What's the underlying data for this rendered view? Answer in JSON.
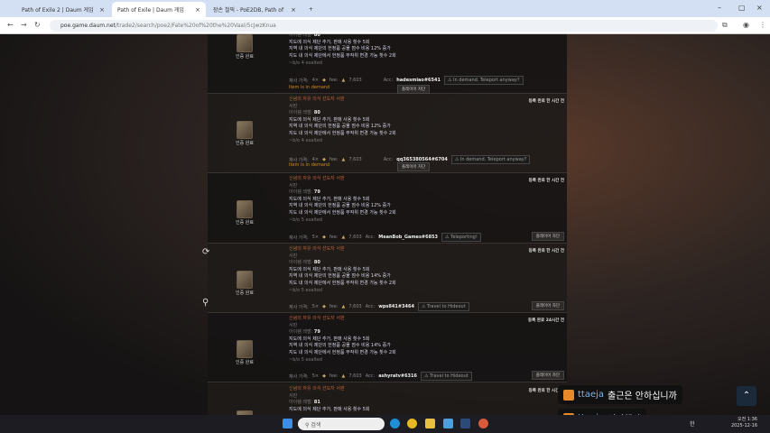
{
  "browser": {
    "tabs": [
      {
        "label": "Path of Exile 2 | Daum 게임"
      },
      {
        "label": "Path of Exile | Daum 게임"
      },
      {
        "label": "장손 철픽 - PoE2DB, Path of"
      }
    ],
    "url_host": "poe.game.daum.net",
    "url_path": "/trade2/search/poe2/Fate%20of%20the%20Vaal/5cJwzKnua"
  },
  "common": {
    "base": "서판",
    "verified": "인증 완료",
    "mod1": "지도에 의식 제단 추가, 판매 사용 횟수 5회",
    "mod3": "지도 내 의식 제단에서 헌정품 무작위 변경 가능 횟수 2회",
    "title": "신념의 자유 의식 선도자 서판",
    "level_label": "아이템 레벨:",
    "price_label": "재사 가격:",
    "fee_label": "fee:",
    "fee": "7,603",
    "acc_label": "Acc:",
    "block": "플레이어 차단",
    "demand": "Item is in demand"
  },
  "listings": [
    {
      "level": "80",
      "mod2": "지역 내 의식 제단의 헌정품 공물 점수 비용 12% 증가",
      "bo": "~b/o 4 exalted",
      "price": "4×",
      "account": "hadesmiao#6541",
      "status": "In demand. Teleport anyway?"
    },
    {
      "ago": "등록 완료 한 시간 전",
      "level": "80",
      "mod2": "지역 내 의식 제단의 헌정품 공물 점수 비용 12% 증가",
      "bo": "~b/o 4 exalted",
      "price": "4×",
      "account": "qq365380564#6704",
      "status": "In demand. Teleport anyway?"
    },
    {
      "ago": "등록 완료 한 시간 전",
      "level": "79",
      "mod2": "지역 내 의식 제단의 헌정품 공물 점수 비용 12% 증가",
      "bo": "~b/o 5 exalted",
      "price": "5×",
      "account": "MeanBob_Games#6853",
      "status": "Teleporting!"
    },
    {
      "ago": "등록 완료 한 시간 전",
      "level": "80",
      "mod2": "지역 내 의식 제단의 헌정품 공물 점수 비용 14% 증가",
      "bo": "~b/o 5 exalted",
      "price": "5×",
      "account": "wps841#3464",
      "status": "Travel to Hideout"
    },
    {
      "ago": "등록 완료 24시간 전",
      "level": "79",
      "mod2": "지역 내 의식 제단의 헌정품 공물 점수 비용 14% 증가",
      "bo": "~b/o 5 exalted",
      "price": "5×",
      "account": "ashyratv#6316",
      "status": "Travel to Hideout"
    },
    {
      "ago": "등록 완료 한 시간 전",
      "level": "81"
    }
  ],
  "chat": [
    {
      "user": "ttaeja",
      "msg": "출근은 안하십니까"
    },
    {
      "user": "ttaeja",
      "msg": "성장했다"
    }
  ],
  "taskbar": {
    "search": "검색",
    "time": "오전 1:36",
    "date": "2025-12-16",
    "lang": "한"
  }
}
